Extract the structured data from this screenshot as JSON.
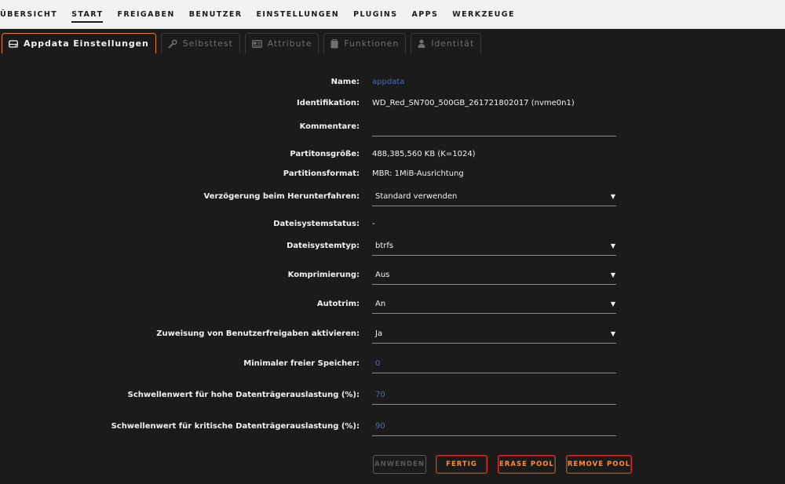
{
  "nav": {
    "items": [
      "ÜBERSICHT",
      "START",
      "FREIGABEN",
      "BENUTZER",
      "EINSTELLUNGEN",
      "PLUGINS",
      "APPS",
      "WERKZEUGE"
    ],
    "active": "START"
  },
  "tabs": [
    {
      "label": "Appdata Einstellungen",
      "icon": "drive-icon",
      "active": true
    },
    {
      "label": "Selbsttest",
      "icon": "wrench-icon",
      "active": false
    },
    {
      "label": "Attribute",
      "icon": "id-card-icon",
      "active": false
    },
    {
      "label": "Funktionen",
      "icon": "clipboard-icon",
      "active": false
    },
    {
      "label": "Identität",
      "icon": "user-icon",
      "active": false
    }
  ],
  "form": {
    "name": {
      "label": "Name:",
      "value": "appdata"
    },
    "identification": {
      "label": "Identifikation:",
      "value": "WD_Red_SN700_500GB_261721802017 (nvme0n1)"
    },
    "comments": {
      "label": "Kommentare:",
      "value": ""
    },
    "partition_size": {
      "label": "Partitonsgröße:",
      "value": "488,385,560 KB (K=1024)"
    },
    "partition_format": {
      "label": "Partitionsformat:",
      "value": "MBR: 1MiB-Ausrichtung"
    },
    "shutdown_delay": {
      "label": "Verzögerung beim Herunterfahren:",
      "value": "Standard verwenden"
    },
    "fs_status": {
      "label": "Dateisystemstatus:",
      "value": "-"
    },
    "fs_type": {
      "label": "Dateisystemtyp:",
      "value": "btrfs"
    },
    "compression": {
      "label": "Komprimierung:",
      "value": "Aus"
    },
    "autotrim": {
      "label": "Autotrim:",
      "value": "An"
    },
    "user_shares": {
      "label": "Zuweisung von Benutzerfreigaben aktivieren:",
      "value": "Ja"
    },
    "min_free": {
      "label": "Minimaler freier Speicher:",
      "value": "0"
    },
    "warn_threshold": {
      "label": "Schwellenwert für hohe Datenträgerauslastung (%):",
      "value": "70"
    },
    "crit_threshold": {
      "label": "Schwellenwert für kritische Datenträgerauslastung (%):",
      "value": "90"
    }
  },
  "buttons": {
    "apply": "ANWENDEN",
    "done": "FERTIG",
    "erase": "ERASE POOL",
    "remove": "REMOVE POOL"
  },
  "colors": {
    "accent": "#e77e32",
    "button_border": "#e22828",
    "button_text": "#ff8c2f",
    "link": "#486dba",
    "background": "#1c1b1b"
  }
}
